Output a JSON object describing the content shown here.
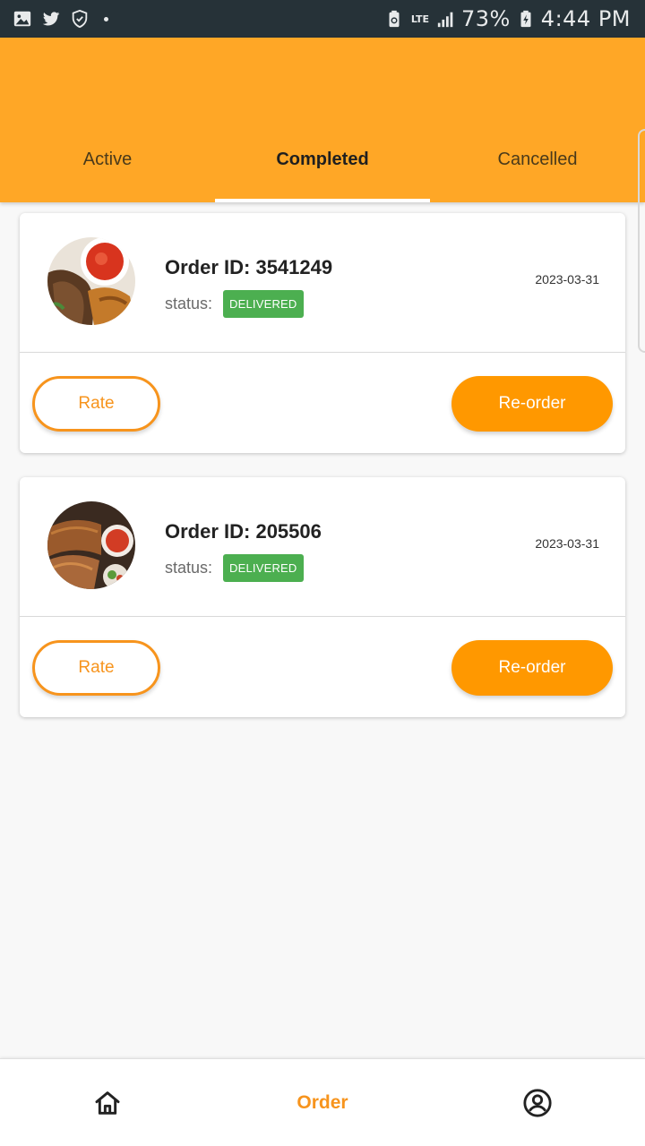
{
  "status_bar": {
    "left_icons": [
      "gallery-icon",
      "twitter-icon",
      "shield-icon",
      "dot-icon"
    ],
    "network": "LTE",
    "battery": "73%",
    "time": "4:44 PM"
  },
  "tabs": [
    {
      "label": "Active",
      "active": false
    },
    {
      "label": "Completed",
      "active": true
    },
    {
      "label": "Cancelled",
      "active": false
    }
  ],
  "orders": [
    {
      "id_text": "Order ID: 3541249",
      "status_label": "status:",
      "status": "DELIVERED",
      "date": "2023-03-31",
      "rate_label": "Rate",
      "reorder_label": "Re-order"
    },
    {
      "id_text": "Order ID: 205506",
      "status_label": "status:",
      "status": "DELIVERED",
      "date": "2023-03-31",
      "rate_label": "Rate",
      "reorder_label": "Re-order"
    }
  ],
  "bottom_nav": {
    "home_icon": "home-icon",
    "order_label": "Order",
    "profile_icon": "account-circle-icon"
  },
  "colors": {
    "header": "#ffa726",
    "accent": "#f7941d",
    "reorder_button": "#ff9800",
    "delivered_badge": "#4caf50",
    "status_bar": "#263238"
  }
}
